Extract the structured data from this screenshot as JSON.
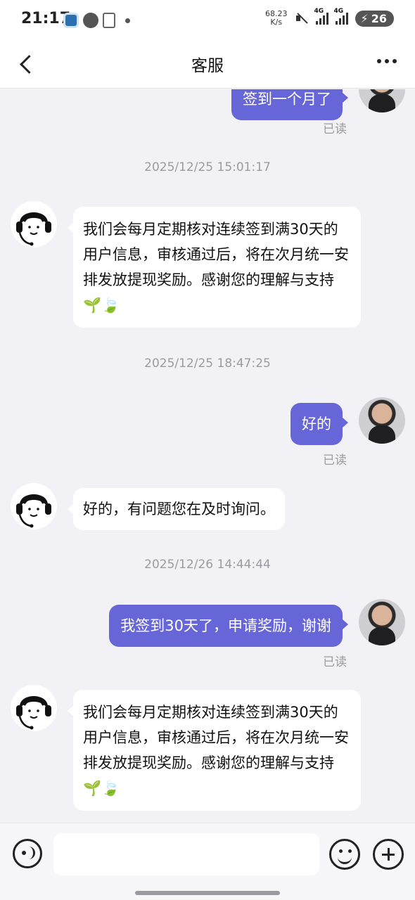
{
  "status_bar": {
    "time": "21:17",
    "net_speed_value": "68.23",
    "net_speed_unit": "K/s",
    "signal1_label": "4G",
    "signal2_label": "4G",
    "battery": "26"
  },
  "header": {
    "title": "客服"
  },
  "chat": {
    "top_partial_user_message": "签到一个月了",
    "top_read_label": "已读",
    "timestamp1": "2025/12/25 15:01:17",
    "agent_message1": "我们会每月定期核对连续签到满30天的用户信息，审核通过后，将在次月统一安排发放提现奖励。感谢您的理解与支持 🌱🍃",
    "timestamp2": "2025/12/25 18:47:25",
    "user_message1": "好的",
    "read_label1": "已读",
    "agent_message2": "好的，有问题您在及时询问。",
    "timestamp3": "2025/12/26 14:44:44",
    "user_message2": "我签到30天了，申请奖励，谢谢",
    "read_label2": "已读",
    "agent_message3": "我们会每月定期核对连续签到满30天的用户信息，审核通过后，将在次月统一安排发放提现奖励。感谢您的理解与支持 🌱🍃"
  },
  "input_bar": {
    "placeholder": ""
  },
  "colors": {
    "user_bubble": "#6766d8",
    "background": "#f2f2f6"
  },
  "icons": {
    "back": "chevron-left-icon",
    "more": "more-horizontal-icon",
    "voice": "voice-icon",
    "emoji": "emoji-icon",
    "plus": "plus-icon"
  }
}
